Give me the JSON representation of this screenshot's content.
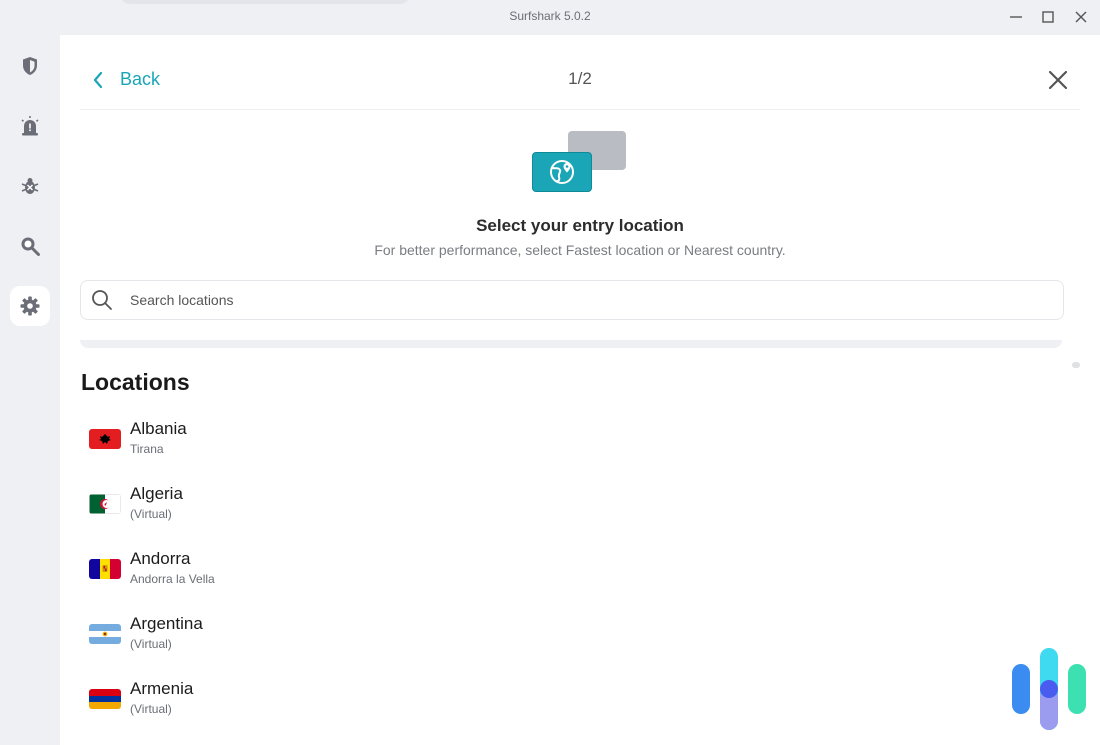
{
  "window": {
    "title": "Surfshark 5.0.2"
  },
  "rail": {
    "items": [
      {
        "name": "shield-icon"
      },
      {
        "name": "alert-icon"
      },
      {
        "name": "bug-icon"
      },
      {
        "name": "search-icon"
      },
      {
        "name": "gear-icon",
        "active": true
      }
    ]
  },
  "header": {
    "back_label": "Back",
    "step": "1/2"
  },
  "intro": {
    "heading": "Select your entry location",
    "subheading": "For better performance, select Fastest location or Nearest country."
  },
  "search": {
    "placeholder": "Search locations",
    "value": ""
  },
  "locations": {
    "title": "Locations",
    "items": [
      {
        "country": "Albania",
        "detail": "Tirana"
      },
      {
        "country": "Algeria",
        "detail": "(Virtual)"
      },
      {
        "country": "Andorra",
        "detail": "Andorra la Vella"
      },
      {
        "country": "Argentina",
        "detail": "(Virtual)"
      },
      {
        "country": "Armenia",
        "detail": "(Virtual)"
      }
    ]
  },
  "colors": {
    "accent": "#1aa6b7",
    "rail_background": "#eef0f4",
    "panel_background": "#ffffff"
  }
}
